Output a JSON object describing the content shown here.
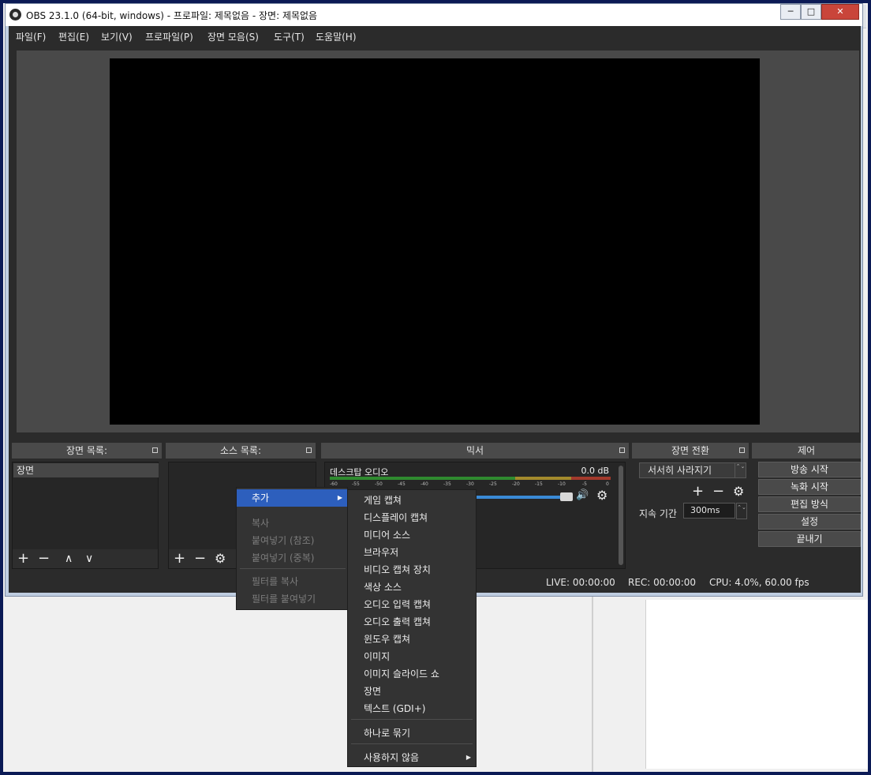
{
  "window": {
    "title": "OBS 23.1.0 (64-bit, windows) - 프로파일: 제목없음 - 장면: 제목없음",
    "min_glyph": "─",
    "max_glyph": "□",
    "close_glyph": "✕"
  },
  "background": {
    "browser_icons": [
      "←",
      "→",
      "↻",
      "⌂",
      "☆"
    ]
  },
  "menu": {
    "items": [
      "파일(F)",
      "편집(E)",
      "보기(V)",
      "프로파일(P)",
      "장면 모음(S)",
      "도구(T)",
      "도움말(H)"
    ]
  },
  "docks": {
    "scenes": {
      "title": "장면 목록:",
      "items": [
        "장면"
      ]
    },
    "sources": {
      "title": "소스 목록:"
    },
    "mixer": {
      "title": "믹서",
      "track_name": "데스크탑 오디오",
      "db": "0.0 dB",
      "ticks": [
        "-60",
        "-55",
        "-50",
        "-45",
        "-40",
        "-35",
        "-30",
        "-25",
        "-20",
        "-15",
        "-10",
        "-5",
        "0"
      ]
    },
    "transitions": {
      "title": "장면 전환",
      "selected": "서서히 사라지기",
      "duration_label": "지속 기간",
      "duration_value": "300ms"
    },
    "controls": {
      "title": "제어",
      "buttons": [
        "방송 시작",
        "녹화 시작",
        "편집 방식",
        "설정",
        "끝내기"
      ]
    }
  },
  "tool_glyphs": {
    "add": "+",
    "remove": "−",
    "up": "∧",
    "down": "∨",
    "gear": "⚙",
    "speaker": "🔊",
    "spin": "⌃⌄"
  },
  "status": {
    "live": "LIVE: 00:00:00",
    "rec": "REC: 00:00:00",
    "cpu": "CPU: 4.0%, 60.00 fps"
  },
  "context_menu": {
    "items": [
      {
        "label": "추가",
        "state": "active",
        "submenu": true
      },
      {
        "label": "복사",
        "state": "disabled"
      },
      {
        "label": "붙여넣기 (참조)",
        "state": "disabled"
      },
      {
        "label": "붙여넣기 (중복)",
        "state": "disabled"
      },
      {
        "label": "필터를 복사",
        "state": "disabled"
      },
      {
        "label": "필터를 붙여넣기",
        "state": "disabled"
      }
    ]
  },
  "add_submenu": {
    "items": [
      "게임 캡쳐",
      "디스플레이 캡쳐",
      "미디어 소스",
      "브라우저",
      "비디오 캡쳐 장치",
      "색상 소스",
      "오디오 입력 캡쳐",
      "오디오 출력 캡쳐",
      "윈도우 캡쳐",
      "이미지",
      "이미지 슬라이드 쇼",
      "장면",
      "텍스트 (GDI+)",
      "하나로 묶기",
      "사용하지 않음"
    ]
  },
  "colors": {
    "obs_bg": "#2b2b2b",
    "highlight": "#2d5fbd",
    "fader": "#3a8ad6"
  }
}
